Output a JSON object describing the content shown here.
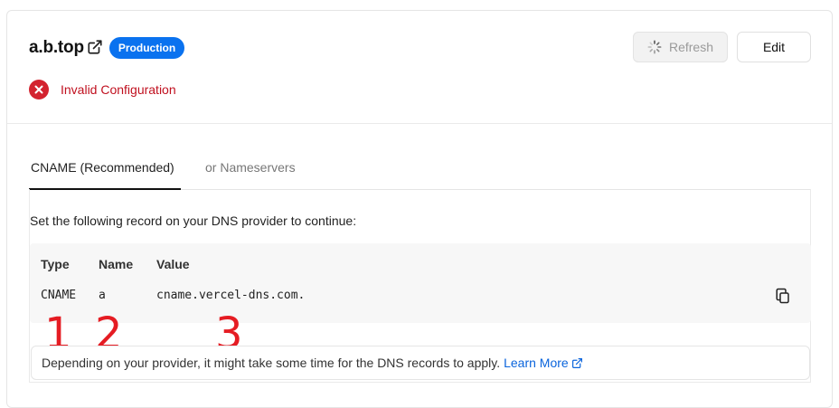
{
  "domain": {
    "name": "a.b.top",
    "link_icon": "external-link-icon",
    "environment_badge": "Production"
  },
  "actions": {
    "refresh_label": "Refresh",
    "refresh_icon": "spinner-icon",
    "edit_label": "Edit"
  },
  "status": {
    "icon": "error-x-icon",
    "text": "Invalid Configuration",
    "color": "#d3232f"
  },
  "tabs": [
    {
      "label": "CNAME (Recommended)",
      "active": true
    },
    {
      "label": "or Nameservers",
      "active": false
    }
  ],
  "instructions": "Set the following record on your DNS provider to continue:",
  "record": {
    "headers": {
      "type": "Type",
      "name": "Name",
      "value": "Value"
    },
    "row": {
      "type": "CNAME",
      "name": "a",
      "value": "cname.vercel-dns.com."
    },
    "copy_icon": "copy-icon"
  },
  "annotations": [
    "1",
    "2",
    "3"
  ],
  "note": {
    "text": "Depending on your provider, it might take some time for the DNS records to apply.",
    "link_label": "Learn More",
    "link_icon": "external-link-icon"
  },
  "colors": {
    "accent": "#0a72ef",
    "link": "#0a64dc",
    "error": "#c0101f",
    "annotation": "#e51c23"
  }
}
